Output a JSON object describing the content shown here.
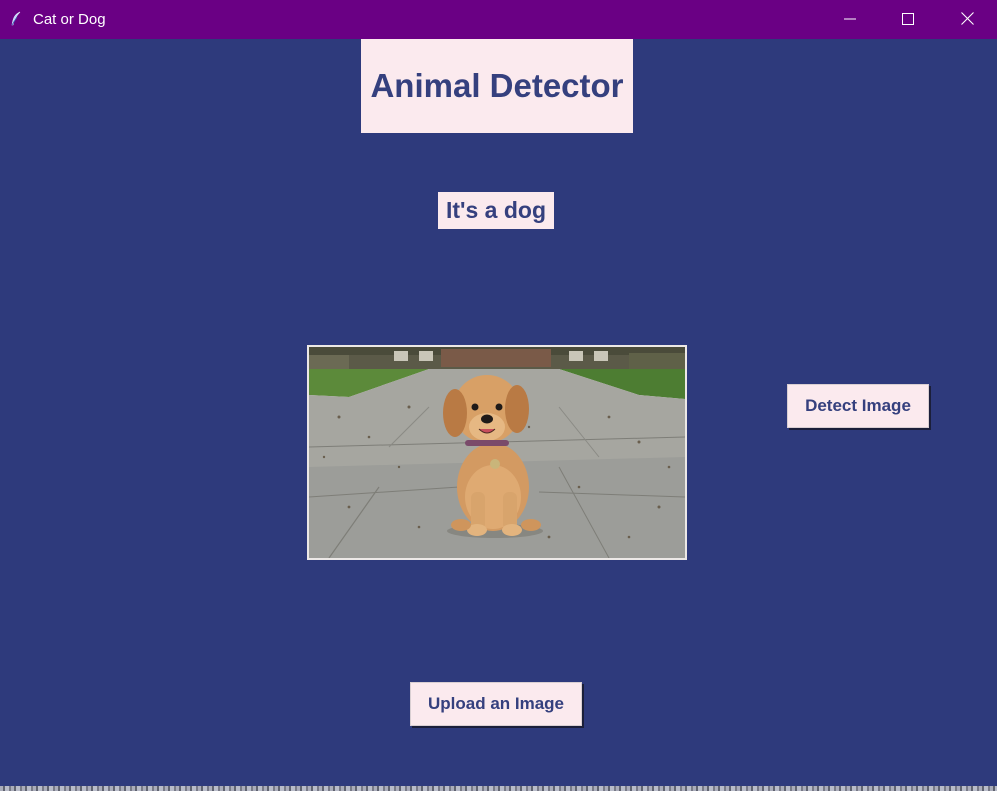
{
  "window": {
    "title": "Cat or Dog",
    "icon": "feather-icon",
    "titlebar_color": "#6a0084",
    "background_color": "#2e3a7c",
    "controls": {
      "minimize": "minimize-icon",
      "maximize": "maximize-icon",
      "close": "close-icon"
    }
  },
  "app": {
    "title": "Animal Detector",
    "result": "It's a dog",
    "image_description_icon": "puppy-photo",
    "accent_color": "#35407e",
    "panel_color": "#fbeaee"
  },
  "buttons": {
    "detect_label": "Detect Image",
    "upload_label": "Upload an Image"
  }
}
